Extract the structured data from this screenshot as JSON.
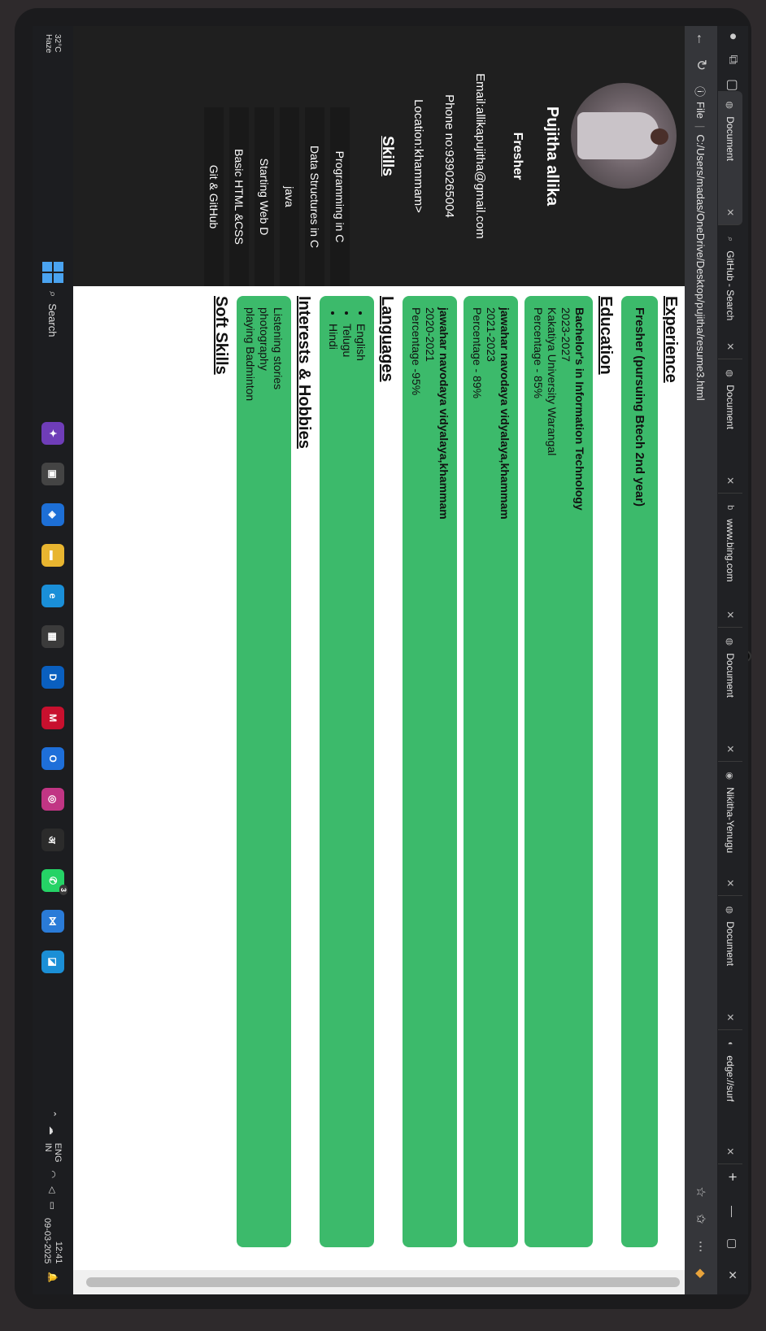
{
  "browser": {
    "tabs": [
      {
        "icon": "document-icon",
        "title": "Document",
        "active": true
      },
      {
        "icon": "search-icon",
        "title": "GitHub - Search",
        "active": false
      },
      {
        "icon": "globe-icon",
        "title": "Document",
        "active": false
      },
      {
        "icon": "bing-icon",
        "title": "www.bing.com",
        "active": false
      },
      {
        "icon": "globe-icon",
        "title": "Document",
        "active": false
      },
      {
        "icon": "github-icon",
        "title": "Nikitha-Yenugu",
        "active": false
      },
      {
        "icon": "globe-icon",
        "title": "Document",
        "active": false
      },
      {
        "icon": "edge-icon",
        "title": "edge://surf",
        "active": false
      }
    ],
    "new_tab_label": "+",
    "address": {
      "scheme_label": "File",
      "url": "C:/Users/madas/OneDrive/Desktop/pujitha/resume3.html"
    }
  },
  "resume": {
    "name": "Pujitha allika",
    "role": "Fresher",
    "email": "Email:allikapujitha@gmail.com",
    "phone": "Phone no:9390265004",
    "location": "Location:khammam>",
    "skills_heading": "Skills",
    "skills": [
      "Programming in C",
      "Data Structures in C",
      "java",
      "Starting Web D",
      "Basic HTML &CSS",
      "Git & GitHub"
    ],
    "experience_heading": "Experience",
    "experience": {
      "title": "Fresher (pursuing Btech 2nd year)"
    },
    "education_heading": "Education",
    "education": [
      {
        "title": "Bachelor's in Information Technology",
        "years": "2023-2027",
        "school": "Kakatiya University Warangal",
        "score": "Percentage - 85%"
      },
      {
        "title": "jawahar navodaya vidyalaya,khammam",
        "years": "2021-2023",
        "school": "",
        "score": "Percentage - 89%"
      },
      {
        "title": "jawahar navodaya vidyalaya,khammam",
        "years": "2020-2021",
        "school": "",
        "score": "Percentage -95%"
      }
    ],
    "languages_heading": "Languages",
    "languages": [
      "English",
      "Telugu",
      "Hindi"
    ],
    "interests_heading": "Interests & Hobbies",
    "interests": [
      "Listening stories",
      "photography",
      "playing Badminton"
    ],
    "soft_skills_heading": "Soft Skills"
  },
  "taskbar": {
    "weather": "32°C",
    "weather_sub": "Haze",
    "search_label": "Search",
    "tray": {
      "language": "ENG",
      "region": "IN",
      "time": "12:41",
      "date": "09-03-2025"
    },
    "badge_count": "3"
  },
  "colors": {
    "card": "#3cba6b",
    "sidebar": "#1f1f1f",
    "tabbar": "#202124"
  }
}
